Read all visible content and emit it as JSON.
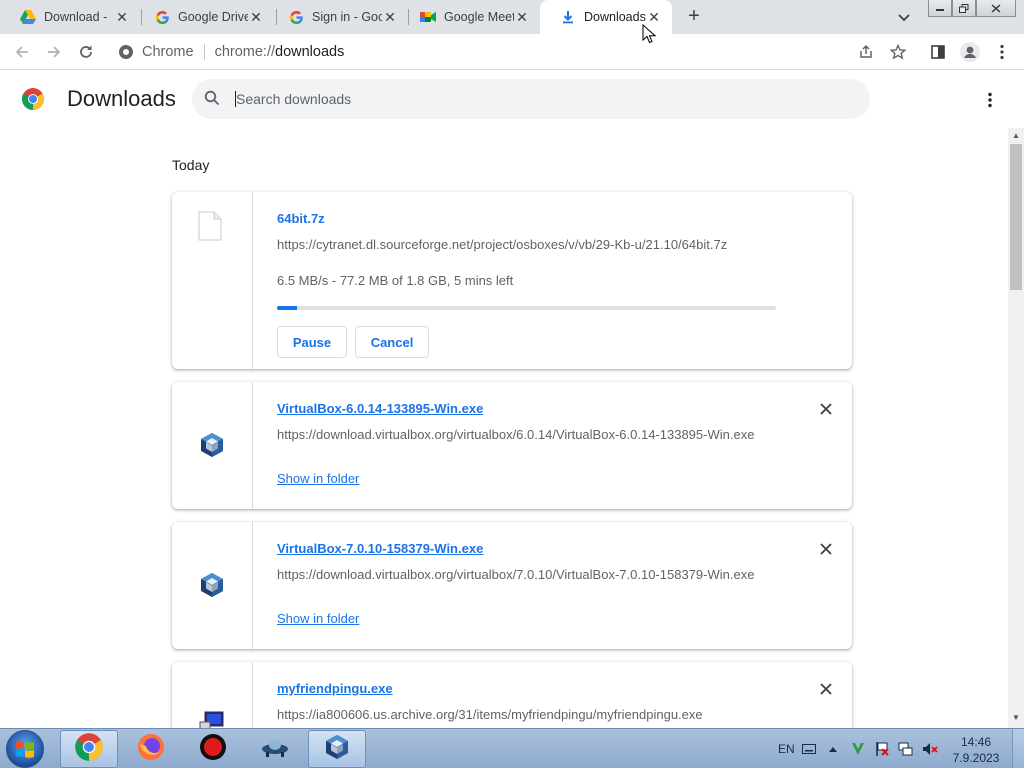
{
  "tabs": [
    {
      "title": "Download - ",
      "favicon": "google-drive-icon",
      "active": false
    },
    {
      "title": "Google Drive",
      "favicon": "google-g-icon",
      "active": false
    },
    {
      "title": "Sign in - Goo",
      "favicon": "google-g-icon",
      "active": false
    },
    {
      "title": "Google Meet",
      "favicon": "google-meet-icon",
      "active": false
    },
    {
      "title": "Downloads",
      "favicon": "download-arrow-icon",
      "active": true
    }
  ],
  "new_tab_label": "+",
  "toolbar": {
    "chip_label": "Chrome",
    "url_scheme": "chrome://",
    "url_host": "downloads"
  },
  "header": {
    "title": "Downloads",
    "search_placeholder": "Search downloads"
  },
  "section_date": "Today",
  "downloads": [
    {
      "name": "64bit.7z",
      "url": "https://cytranet.dl.sourceforge.net/project/osboxes/v/vb/29-Kb-u/21.10/64bit.7z",
      "status": "6.5 MB/s - 77.2 MB of 1.8 GB, 5 mins left",
      "progress": 0.04,
      "pause_label": "Pause",
      "cancel_label": "Cancel",
      "icon": "generic-file-icon"
    },
    {
      "name": "VirtualBox-6.0.14-133895-Win.exe",
      "url": "https://download.virtualbox.org/virtualbox/6.0.14/VirtualBox-6.0.14-133895-Win.exe",
      "action": "Show in folder",
      "icon": "virtualbox-icon"
    },
    {
      "name": "VirtualBox-7.0.10-158379-Win.exe",
      "url": "https://download.virtualbox.org/virtualbox/7.0.10/VirtualBox-7.0.10-158379-Win.exe",
      "action": "Show in folder",
      "icon": "virtualbox-icon"
    },
    {
      "name": "myfriendpingu.exe",
      "url": "https://ia800606.us.archive.org/31/items/myfriendpingu/myfriendpingu.exe",
      "icon": "installer-icon"
    }
  ],
  "taskbar": {
    "language": "EN",
    "time": "14:46",
    "date": "7.9.2023",
    "items": [
      "chrome-icon",
      "firefox-icon",
      "recorder-icon",
      "ufo-icon",
      "virtualbox-icon"
    ]
  },
  "colors": {
    "accent": "#1a73e8",
    "tabstrip": "#dee1e6",
    "taskbar": "#9db6d8"
  }
}
